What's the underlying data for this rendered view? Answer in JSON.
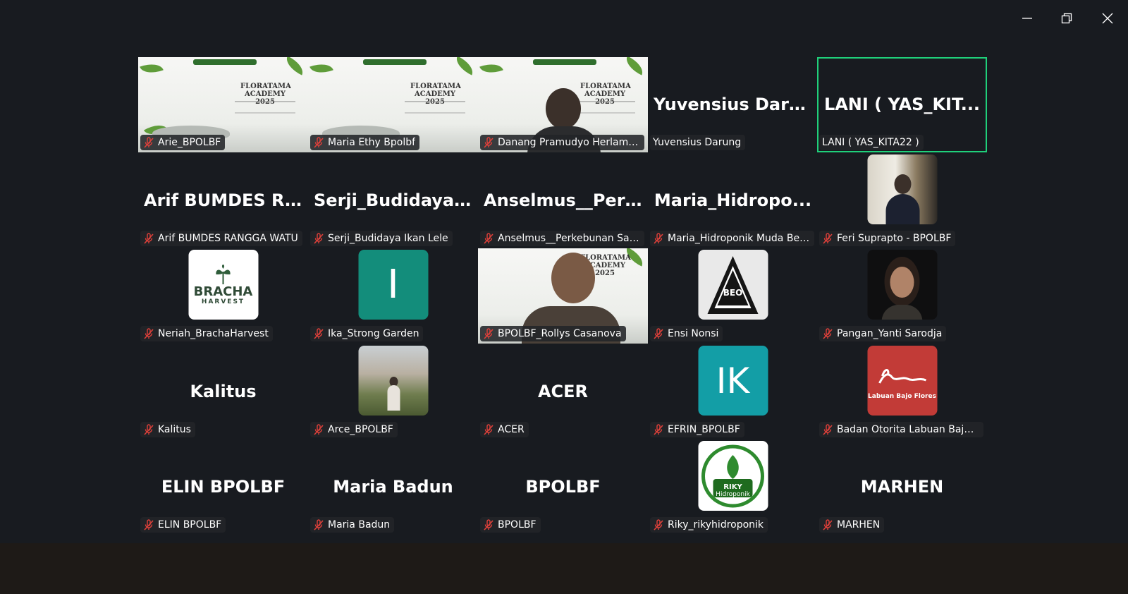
{
  "window": {
    "minimize_icon": "minimize-icon",
    "restore_icon": "restore-icon",
    "close_icon": "close-icon"
  },
  "colors": {
    "active_border": "#1fd07a",
    "mic_muted": "#e0403a",
    "teal": "#138d7b",
    "cyan": "#139ea6",
    "red": "#c23b37"
  },
  "participants": [
    {
      "name": "Arie_BPOLBF",
      "display": "",
      "muted": true,
      "video": "slide"
    },
    {
      "name": "Maria Ethy Bpolbf",
      "display": "",
      "muted": true,
      "video": "slide"
    },
    {
      "name": "Danang Pramudyo Herlamb...",
      "display": "",
      "muted": true,
      "video": "slide-person"
    },
    {
      "name": "Yuvensius Darung",
      "display": "Yuvensius Darung",
      "muted": false,
      "video": "none"
    },
    {
      "name": "LANI ( YAS_KITA22 )",
      "display": "LANI ( YAS_KIT...",
      "muted": false,
      "video": "none",
      "active_speaker": true
    },
    {
      "name": "Arif BUMDES RANGGA WATU",
      "display": "Arif BUMDES R...",
      "muted": true,
      "video": "none"
    },
    {
      "name": "Serji_Budidaya Ikan Lele",
      "display": "Serji_Budidaya I...",
      "muted": true,
      "video": "none"
    },
    {
      "name": "Anselmus__Perkebunan Sayur",
      "display": "Anselmus__Perk...",
      "muted": true,
      "video": "none"
    },
    {
      "name": "Maria_Hidroponik Muda Ber...",
      "display": "Maria_Hidropo...",
      "muted": true,
      "video": "none"
    },
    {
      "name": "Feri Suprapto - BPOLBF",
      "display": "",
      "muted": true,
      "video": "photo"
    },
    {
      "name": "Neriah_BrachaHarvest",
      "display": "",
      "muted": true,
      "video": "logo",
      "logo_text": "BRACHA",
      "logo_sub": "HARVEST"
    },
    {
      "name": "Ika_Strong Garden",
      "display": "",
      "muted": true,
      "video": "letter",
      "letter": "I"
    },
    {
      "name": "BPOLBF_Rollys Casanova",
      "display": "",
      "muted": true,
      "video": "slide-person"
    },
    {
      "name": "Ensi Nonsi",
      "display": "",
      "muted": true,
      "video": "logo",
      "logo_text": "BEO"
    },
    {
      "name": "Pangan_Yanti Sarodja",
      "display": "",
      "muted": true,
      "video": "photo"
    },
    {
      "name": "Kalitus",
      "display": "Kalitus",
      "muted": true,
      "video": "none"
    },
    {
      "name": "Arce_BPOLBF",
      "display": "",
      "muted": true,
      "video": "photo"
    },
    {
      "name": "ACER",
      "display": "ACER",
      "muted": true,
      "video": "none"
    },
    {
      "name": "EFRIN_BPOLBF",
      "display": "",
      "muted": true,
      "video": "letter",
      "letter": "IK"
    },
    {
      "name": "Badan Otorita Labuan Bajo ...",
      "display": "",
      "muted": true,
      "video": "logo",
      "logo_text": "Labuan Bajo Flores"
    },
    {
      "name": "ELIN BPOLBF",
      "display": "ELIN BPOLBF",
      "muted": true,
      "video": "none"
    },
    {
      "name": "Maria Badun",
      "display": "Maria Badun",
      "muted": true,
      "video": "none"
    },
    {
      "name": "BPOLBF",
      "display": "BPOLBF",
      "muted": true,
      "video": "none"
    },
    {
      "name": "Riky_rikyhidroponik",
      "display": "",
      "muted": true,
      "video": "logo",
      "logo_text": "RIKY",
      "logo_sub": "Hidroponik"
    },
    {
      "name": "MARHEN",
      "display": "MARHEN",
      "muted": true,
      "video": "none"
    }
  ],
  "slide": {
    "title_line1": "FLORATAMA",
    "title_line2": "ACADEMY 2025"
  }
}
